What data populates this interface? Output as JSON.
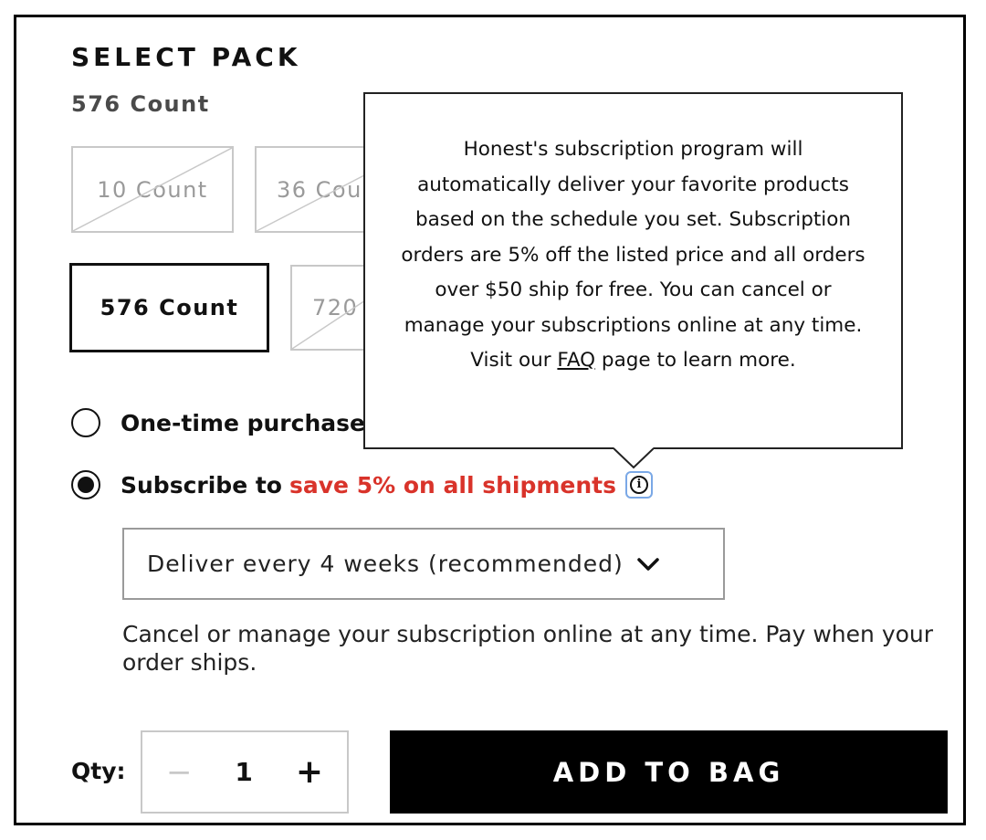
{
  "pack": {
    "heading": "SELECT PACK",
    "selected_label": "576 Count",
    "options": [
      {
        "label": "10 Count",
        "available": false
      },
      {
        "label": "36 Cou",
        "available": false
      },
      {
        "label": "576 Count",
        "available": true,
        "selected": true
      },
      {
        "label": "720",
        "available": false
      }
    ]
  },
  "purchase": {
    "one_time_label": "One-time purchase",
    "subscribe_prefix": "Subscribe to",
    "subscribe_savings": "save 5% on all shipments",
    "selected": "subscribe",
    "info_icon": "info-icon"
  },
  "tooltip": {
    "text_before": "Honest's subscription program will automatically deliver your favorite products based on the schedule you set. Subscription orders are 5% off the listed price and all orders over $50 ship for free. You can cancel or manage your subscriptions online at any time. Visit our",
    "link_text": "FAQ",
    "text_after": "page to learn more."
  },
  "delivery": {
    "selected_value": "Deliver every 4 weeks (recommended)",
    "note": "Cancel or manage your subscription online at any time. Pay when your order ships."
  },
  "quantity": {
    "label": "Qty:",
    "value": "1",
    "minus": "−",
    "plus": "+"
  },
  "cta": {
    "label": "ADD TO BAG"
  },
  "colors": {
    "accent_red": "#d9332a",
    "button_bg": "#000000",
    "disabled_text": "#9a9a9a",
    "info_focus": "#7aa8e6"
  }
}
